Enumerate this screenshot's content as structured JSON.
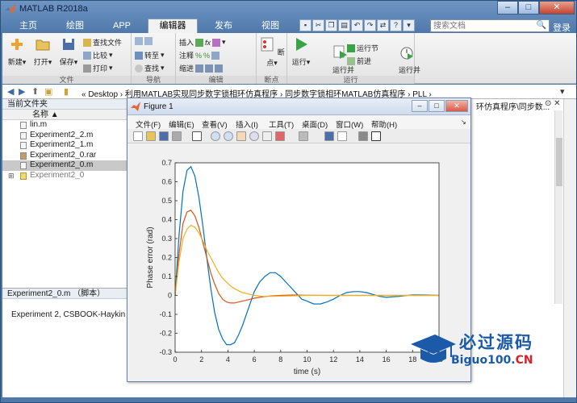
{
  "window": {
    "title": "MATLAB R2018a"
  },
  "ribbon_tabs": [
    {
      "label": "主页"
    },
    {
      "label": "绘图"
    },
    {
      "label": "APP"
    },
    {
      "label": "编辑器"
    },
    {
      "label": "发布"
    },
    {
      "label": "视图"
    }
  ],
  "search": {
    "placeholder": "搜索文档"
  },
  "login_label": "登录",
  "ribbon": {
    "file_group": {
      "label": "文件",
      "new": "新建",
      "open": "打开",
      "save": "保存",
      "find_files": "查找文件",
      "compare": "比较",
      "print": "打印"
    },
    "nav_group": {
      "label": "导航",
      "goto": "转至",
      "find": "查找"
    },
    "edit_group": {
      "label": "编辑",
      "insert": "插入",
      "comment": "注释",
      "indent": "缩进"
    },
    "breakpoint_group": {
      "label": "断点",
      "breakpoints": "断点"
    },
    "run_group": {
      "label": "运行",
      "run": "运行",
      "run_advance": "运行并\n前进",
      "run_section": "运行节",
      "advance": "前进",
      "run_time": "运行并\n计时"
    }
  },
  "address": {
    "crumbs": "« Desktop › 利用MATLAB实现同步数字锁相环仿真程序 › 同步数字锁相环MATLAB仿真程序 › PLL ›"
  },
  "file_panel": {
    "title": "当前文件夹",
    "column_header": "名称 ▲",
    "files": [
      {
        "name": "lin.m",
        "selected": false,
        "folder": false
      },
      {
        "name": "Experiment2_2.m",
        "selected": false,
        "folder": false
      },
      {
        "name": "Experiment2_1.m",
        "selected": false,
        "folder": false
      },
      {
        "name": "Experiment2_0.rar",
        "selected": false,
        "folder": false
      },
      {
        "name": "Experiment2_0.m",
        "selected": true,
        "folder": false
      },
      {
        "name": "Experiment2_0",
        "selected": false,
        "folder": true
      }
    ]
  },
  "details": {
    "title": "Experiment2_0.m （脚本）",
    "text": "Experiment 2, CSBOOK-Haykin"
  },
  "editor": {
    "title_fragment": "环仿真程序\\同步数..."
  },
  "figure": {
    "title": "Figure 1",
    "menu": [
      {
        "label": "文件(F)"
      },
      {
        "label": "编辑(E)"
      },
      {
        "label": "查看(V)"
      },
      {
        "label": "插入(I)"
      },
      {
        "label": "工具(T)"
      },
      {
        "label": "桌面(D)"
      },
      {
        "label": "窗口(W)"
      },
      {
        "label": "帮助(H)"
      }
    ]
  },
  "chart_data": {
    "type": "line",
    "xlabel": "time (s)",
    "ylabel": "Phase error (rad)",
    "xlim": [
      0,
      20
    ],
    "ylim": [
      -0.3,
      0.7
    ],
    "xticks": [
      0,
      2,
      4,
      6,
      8,
      10,
      12,
      14,
      16,
      18,
      20
    ],
    "yticks": [
      -0.3,
      -0.2,
      -0.1,
      0,
      0.1,
      0.2,
      0.3,
      0.4,
      0.5,
      0.6,
      0.7
    ],
    "grid": false,
    "series": [
      {
        "color": "#0072bd",
        "x": [
          0,
          0.3,
          0.6,
          0.9,
          1.2,
          1.5,
          1.8,
          2.1,
          2.4,
          2.7,
          3.0,
          3.3,
          3.6,
          3.9,
          4.2,
          4.5,
          4.8,
          5.1,
          5.4,
          5.7,
          6.0,
          6.4,
          6.8,
          7.2,
          7.6,
          8.0,
          8.4,
          8.8,
          9.2,
          9.6,
          10.0,
          10.5,
          11.0,
          11.5,
          12.0,
          12.5,
          13.0,
          13.5,
          14.0,
          14.5,
          15.0,
          15.5,
          16.0,
          17.0,
          18.0,
          19.0,
          20.0
        ],
        "y": [
          0.0,
          0.32,
          0.55,
          0.66,
          0.68,
          0.63,
          0.52,
          0.37,
          0.2,
          0.04,
          -0.09,
          -0.18,
          -0.23,
          -0.26,
          -0.26,
          -0.25,
          -0.21,
          -0.16,
          -0.1,
          -0.04,
          0.02,
          0.07,
          0.1,
          0.12,
          0.12,
          0.1,
          0.07,
          0.04,
          0.01,
          -0.02,
          -0.03,
          -0.045,
          -0.045,
          -0.035,
          -0.02,
          0.0,
          0.015,
          0.02,
          0.02,
          0.015,
          0.005,
          -0.005,
          -0.01,
          -0.005,
          0.003,
          0.002,
          0.0
        ]
      },
      {
        "color": "#d95319",
        "x": [
          0,
          0.3,
          0.6,
          0.9,
          1.2,
          1.5,
          1.8,
          2.1,
          2.4,
          2.7,
          3.0,
          3.3,
          3.6,
          3.9,
          4.2,
          4.5,
          4.8,
          5.1,
          5.4,
          6.0,
          6.6,
          7.2,
          8.0,
          9.0,
          10.0,
          12.0,
          14.0,
          16.0,
          18.0,
          20.0
        ],
        "y": [
          0.0,
          0.22,
          0.38,
          0.44,
          0.45,
          0.42,
          0.36,
          0.28,
          0.2,
          0.12,
          0.06,
          0.01,
          -0.02,
          -0.035,
          -0.04,
          -0.04,
          -0.035,
          -0.03,
          -0.025,
          -0.015,
          -0.008,
          -0.003,
          0.0,
          0.002,
          0.001,
          0.0,
          0.0,
          0.0,
          0.0,
          0.0
        ]
      },
      {
        "color": "#edb120",
        "x": [
          0,
          0.3,
          0.6,
          0.9,
          1.2,
          1.5,
          1.8,
          2.1,
          2.4,
          2.7,
          3.0,
          3.3,
          3.6,
          3.9,
          4.2,
          4.5,
          4.8,
          5.1,
          5.4,
          6.0,
          6.6,
          7.2,
          8.0,
          9.0,
          10.0,
          12.0,
          14.0,
          16.0,
          18.0,
          20.0
        ],
        "y": [
          0.0,
          0.18,
          0.3,
          0.35,
          0.37,
          0.36,
          0.33,
          0.29,
          0.24,
          0.2,
          0.16,
          0.12,
          0.09,
          0.07,
          0.05,
          0.035,
          0.025,
          0.015,
          0.01,
          0.0,
          -0.005,
          -0.005,
          -0.004,
          -0.002,
          0.0,
          0.0,
          0.0,
          0.0,
          0.0,
          0.0
        ]
      }
    ]
  },
  "watermark": {
    "line1": "必过源码",
    "line2a": "Biguo100.",
    "line2b": "CN"
  }
}
